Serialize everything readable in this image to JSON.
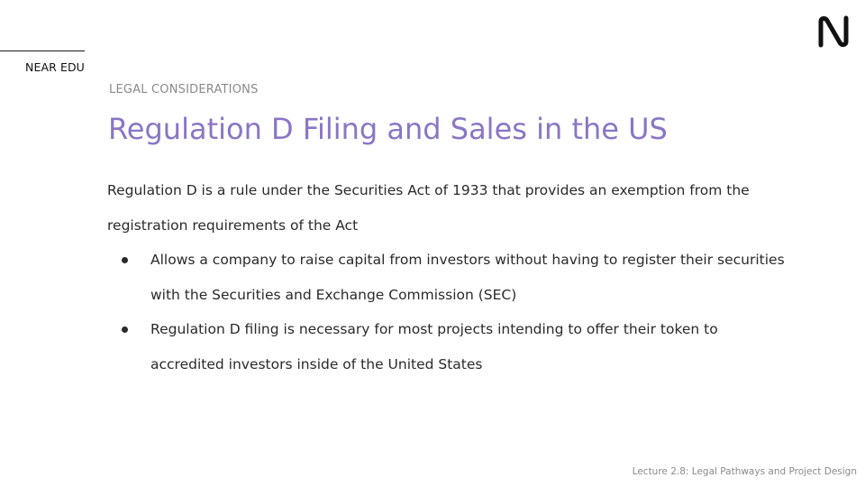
{
  "brand": {
    "label": "NEAR EDU",
    "logo_icon": "near-logo-icon"
  },
  "slide": {
    "section": "LEGAL CONSIDERATIONS",
    "title": "Regulation D Filing and Sales in the US",
    "intro": "Regulation D is a rule under the Securities Act of 1933 that provides an exemption from the registration requirements of the Act",
    "bullets": [
      "Allows a company to raise capital from investors without having to register their securities with the Securities and Exchange Commission (SEC)",
      "Regulation D filing is necessary for most projects intending to offer their token to accredited investors inside of the United States"
    ]
  },
  "footer": {
    "lecture": "Lecture 2.8: Legal Pathways and Project Design"
  },
  "colors": {
    "title": "#8a76c4",
    "text": "#2a2a2a",
    "muted": "#8a8a8a",
    "brand": "#111111"
  }
}
